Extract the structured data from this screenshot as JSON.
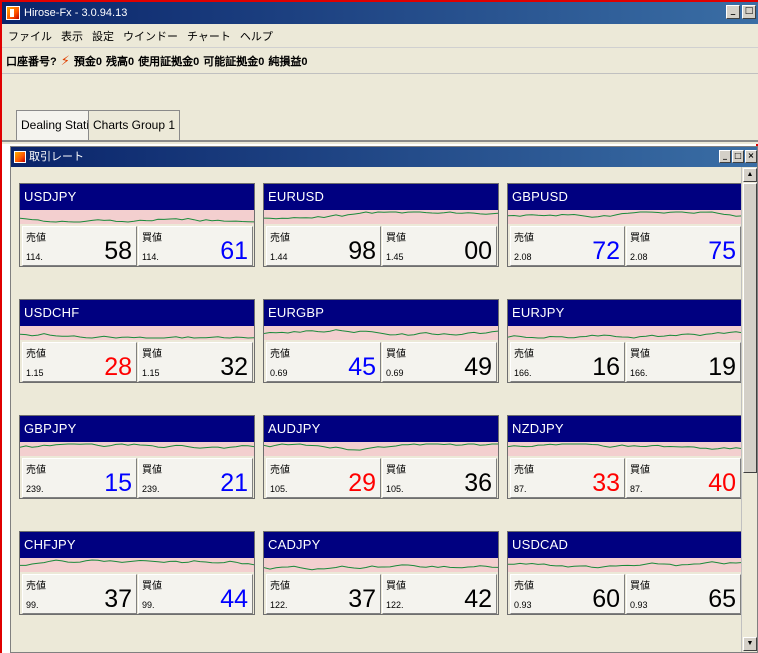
{
  "app": {
    "title": "Hirose-Fx - 3.0.94.13",
    "menu": [
      "ファイル",
      "表示",
      "設定",
      "ウインドー",
      "チャート",
      "ヘルプ"
    ]
  },
  "toolbar": {
    "items": [
      "口座番号?",
      "預金0",
      "残高0",
      "使用証拠金0",
      "可能証拠金0",
      "純損益0"
    ]
  },
  "tabs": [
    {
      "label": "Dealing Station",
      "active": true
    },
    {
      "label": "Charts Group 1",
      "active": false
    }
  ],
  "subwindow": {
    "title": "取引レート"
  },
  "colors": {
    "up": "#0000ff",
    "down": "#ff0000",
    "neutral": "#000000",
    "header": "#000080",
    "spark_bg": "#f3cfcf",
    "spark_line": "#1a8a3a"
  },
  "pairs": [
    {
      "symbol": "USDJPY",
      "sell_label": "売値",
      "buy_label": "買値",
      "sell_big": "114.",
      "sell_pips": "58",
      "sell_color": "neutral",
      "buy_big": "114.",
      "buy_pips": "61",
      "buy_color": "up"
    },
    {
      "symbol": "EURUSD",
      "sell_label": "売値",
      "buy_label": "買値",
      "sell_big": "1.44",
      "sell_pips": "98",
      "sell_color": "neutral",
      "buy_big": "1.45",
      "buy_pips": "00",
      "buy_color": "neutral"
    },
    {
      "symbol": "GBPUSD",
      "sell_label": "売値",
      "buy_label": "買値",
      "sell_big": "2.08",
      "sell_pips": "72",
      "sell_color": "up",
      "buy_big": "2.08",
      "buy_pips": "75",
      "buy_color": "up"
    },
    {
      "symbol": "USDCHF",
      "sell_label": "売値",
      "buy_label": "買値",
      "sell_big": "1.15",
      "sell_pips": "28",
      "sell_color": "down",
      "buy_big": "1.15",
      "buy_pips": "32",
      "buy_color": "neutral"
    },
    {
      "symbol": "EURGBP",
      "sell_label": "売値",
      "buy_label": "買値",
      "sell_big": "0.69",
      "sell_pips": "45",
      "sell_color": "up",
      "buy_big": "0.69",
      "buy_pips": "49",
      "buy_color": "neutral"
    },
    {
      "symbol": "EURJPY",
      "sell_label": "売値",
      "buy_label": "買値",
      "sell_big": "166.",
      "sell_pips": "16",
      "sell_color": "neutral",
      "buy_big": "166.",
      "buy_pips": "19",
      "buy_color": "neutral"
    },
    {
      "symbol": "GBPJPY",
      "sell_label": "売値",
      "buy_label": "買値",
      "sell_big": "239.",
      "sell_pips": "15",
      "sell_color": "up",
      "buy_big": "239.",
      "buy_pips": "21",
      "buy_color": "up"
    },
    {
      "symbol": "AUDJPY",
      "sell_label": "売値",
      "buy_label": "買値",
      "sell_big": "105.",
      "sell_pips": "29",
      "sell_color": "down",
      "buy_big": "105.",
      "buy_pips": "36",
      "buy_color": "neutral"
    },
    {
      "symbol": "NZDJPY",
      "sell_label": "売値",
      "buy_label": "買値",
      "sell_big": "87.",
      "sell_pips": "33",
      "sell_color": "down",
      "buy_big": "87.",
      "buy_pips": "40",
      "buy_color": "down"
    },
    {
      "symbol": "CHFJPY",
      "sell_label": "売値",
      "buy_label": "買値",
      "sell_big": "99.",
      "sell_pips": "37",
      "sell_color": "neutral",
      "buy_big": "99.",
      "buy_pips": "44",
      "buy_color": "up"
    },
    {
      "symbol": "CADJPY",
      "sell_label": "売値",
      "buy_label": "買値",
      "sell_big": "122.",
      "sell_pips": "37",
      "sell_color": "neutral",
      "buy_big": "122.",
      "buy_pips": "42",
      "buy_color": "neutral"
    },
    {
      "symbol": "USDCAD",
      "sell_label": "売値",
      "buy_label": "買値",
      "sell_big": "0.93",
      "sell_pips": "60",
      "sell_color": "neutral",
      "buy_big": "0.93",
      "buy_pips": "65",
      "buy_color": "neutral"
    }
  ]
}
